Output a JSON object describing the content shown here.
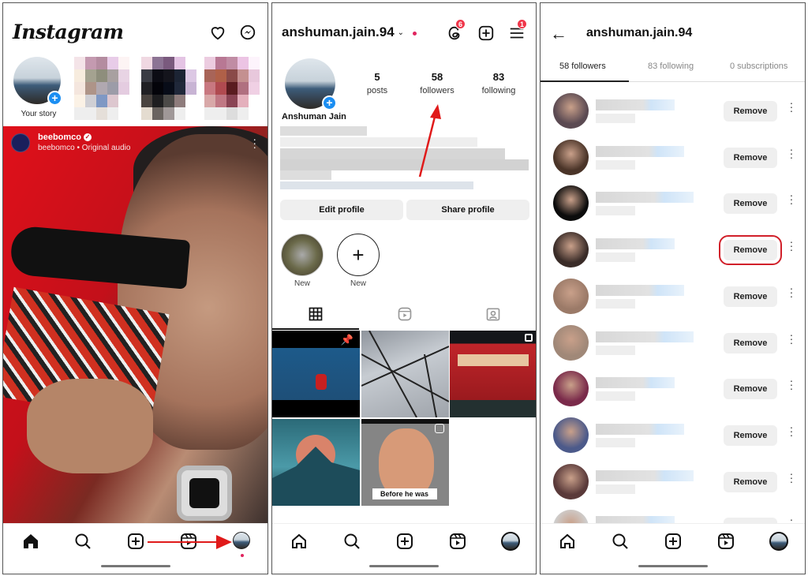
{
  "feed": {
    "logo": "Instagram",
    "header_icons": [
      "heart-icon",
      "messenger-icon"
    ],
    "stories": [
      {
        "label": "Your story",
        "own": true
      },
      {
        "label": "",
        "blurred": true
      },
      {
        "label": "",
        "blurred": true
      },
      {
        "label": "",
        "blurred": true
      }
    ],
    "post": {
      "username": "beebomco",
      "verified": true,
      "subtitle": "beebomco • Original audio"
    },
    "nav": [
      "home-icon",
      "search-icon",
      "create-icon",
      "reels-icon",
      "profile-avatar"
    ],
    "annotation": "arrow pointing to profile tab"
  },
  "profile": {
    "username": "anshuman.jain.94",
    "threads_badge": "6",
    "menu_badge": "1",
    "display_name": "Anshuman Jain",
    "stats": [
      {
        "value": "5",
        "label": "posts"
      },
      {
        "value": "58",
        "label": "followers"
      },
      {
        "value": "83",
        "label": "following"
      }
    ],
    "buttons": {
      "edit": "Edit profile",
      "share": "Share profile"
    },
    "highlights": [
      {
        "label": "New",
        "type": "image"
      },
      {
        "label": "New",
        "type": "add"
      }
    ],
    "tabs": [
      "grid-icon",
      "reels-icon",
      "tagged-icon"
    ],
    "grid": [
      {
        "name": "post-pinned",
        "pinned": true
      },
      {
        "name": "post-wires"
      },
      {
        "name": "post-bus",
        "carousel": true
      },
      {
        "name": "post-moon"
      },
      {
        "name": "post-reel",
        "reel": true,
        "caption": "Before he was"
      }
    ],
    "annotation": "arrow pointing to followers"
  },
  "followers": {
    "title": "anshuman.jain.94",
    "tabs": [
      {
        "label": "58 followers",
        "active": true
      },
      {
        "label": "83 following",
        "active": false
      },
      {
        "label": "0 subscriptions",
        "active": false
      }
    ],
    "remove_label": "Remove",
    "rows": [
      {
        "highlighted": false
      },
      {
        "highlighted": false
      },
      {
        "highlighted": false
      },
      {
        "highlighted": true
      },
      {
        "highlighted": false
      },
      {
        "highlighted": false
      },
      {
        "highlighted": false
      },
      {
        "highlighted": false
      },
      {
        "highlighted": false
      },
      {
        "highlighted": false
      }
    ]
  }
}
